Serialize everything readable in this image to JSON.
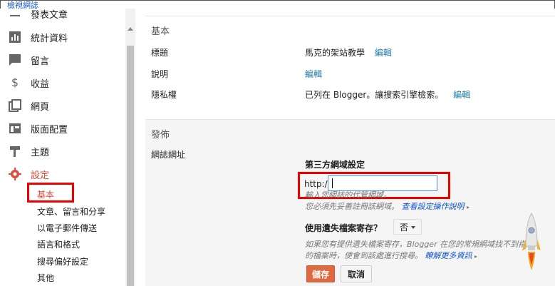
{
  "header": {
    "view_blog": "檢視網誌"
  },
  "sidebar": {
    "items": [
      {
        "label": "發表文章",
        "icon": "list-icon"
      },
      {
        "label": "統計資料",
        "icon": "stats-icon"
      },
      {
        "label": "留言",
        "icon": "comment-icon"
      },
      {
        "label": "收益",
        "icon": "dollar-icon"
      },
      {
        "label": "網頁",
        "icon": "pages-icon"
      },
      {
        "label": "版面配置",
        "icon": "layout-icon"
      },
      {
        "label": "主題",
        "icon": "theme-icon"
      },
      {
        "label": "設定",
        "icon": "gear-icon"
      }
    ],
    "sub_items": [
      {
        "label": "基本"
      },
      {
        "label": "文章、留言和分享"
      },
      {
        "label": "以電子郵件傳送"
      },
      {
        "label": "語言和格式"
      },
      {
        "label": "搜尋偏好設定"
      },
      {
        "label": "其他"
      }
    ],
    "active_color": "#dd4b39"
  },
  "basic": {
    "title": "基本",
    "rows": [
      {
        "label": "標題",
        "value": "馬克的架站教學",
        "edit": "編輯"
      },
      {
        "label": "說明",
        "value": "",
        "edit": "編輯"
      },
      {
        "label": "隱私權",
        "value": "已列在 Blogger。讓搜索引擎檢索。",
        "edit": "編輯"
      }
    ]
  },
  "publish": {
    "title": "發佈",
    "blog_address_label": "網誌網址",
    "third_party_title": "第三方網域設定",
    "http_prefix": "http://",
    "url_value": "",
    "hint_line1": "輸入您網誌的代管網域。",
    "hint_line2": "您必須先妥善註冊該網域。",
    "hint_link": "查看設定操作說明",
    "missing_files_label": "使用遺失檔案寄存？",
    "missing_files_value": "否",
    "desc_line1": "如果您有提供遺失檔案寄存，Blogger 在您的常規網域找不到指定",
    "desc_line2": "的檔案時，便會到該處進行搜尋。",
    "desc_link": "瞭解更多資訊",
    "save": "儲存",
    "cancel": "取消"
  },
  "colors": {
    "link": "#1155cc",
    "save_button": "#dd6a40",
    "highlight_box": "#ee0000"
  }
}
